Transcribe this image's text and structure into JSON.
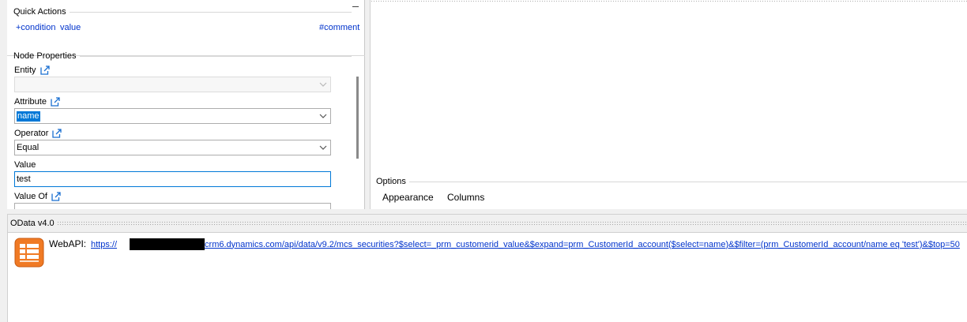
{
  "quick_actions": {
    "title": "Quick Actions",
    "links": [
      {
        "label": "+condition"
      },
      {
        "label": "value"
      },
      {
        "label": "#comment"
      }
    ]
  },
  "node_properties": {
    "title": "Node Properties",
    "entity": {
      "label": "Entity",
      "value": ""
    },
    "attribute": {
      "label": "Attribute",
      "value": "name"
    },
    "operator": {
      "label": "Operator",
      "value": "Equal"
    },
    "value": {
      "label": "Value",
      "value": "test"
    },
    "value_of": {
      "label": "Value Of"
    }
  },
  "options": {
    "title": "Options",
    "tabs": [
      {
        "label": "Appearance"
      },
      {
        "label": "Columns"
      }
    ]
  },
  "odata": {
    "title": "OData v4.0",
    "label": "WebAPI:",
    "url_scheme": "https://",
    "url_rest": "crm6.dynamics.com/api/data/v9.2/mcs_securities?$select=_prm_customerid_value&$expand=prm_CustomerId_account($select=name)&$filter=(prm_CustomerId_account/name eq 'test')&$top=50"
  },
  "colors": {
    "link": "#0033cc",
    "selection": "#0078d7",
    "focus_border": "#0078d7",
    "icon_orange": "#f07a24"
  }
}
